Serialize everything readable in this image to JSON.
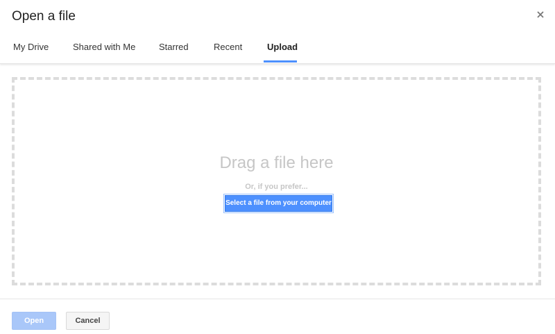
{
  "dialog": {
    "title": "Open a file"
  },
  "tabs": [
    {
      "label": "My Drive"
    },
    {
      "label": "Shared with Me"
    },
    {
      "label": "Starred"
    },
    {
      "label": "Recent"
    },
    {
      "label": "Upload",
      "active": true
    }
  ],
  "upload": {
    "drag_text": "Drag a file here",
    "or_text": "Or, if you prefer...",
    "select_button": "Select a file from your computer"
  },
  "footer": {
    "open_label": "Open",
    "cancel_label": "Cancel",
    "open_enabled": false
  },
  "colors": {
    "accent": "#4d90fe",
    "disabled_accent": "#a9c7f9",
    "dashed_border": "#dcdcdc"
  },
  "icons": {
    "close": "close-icon"
  }
}
